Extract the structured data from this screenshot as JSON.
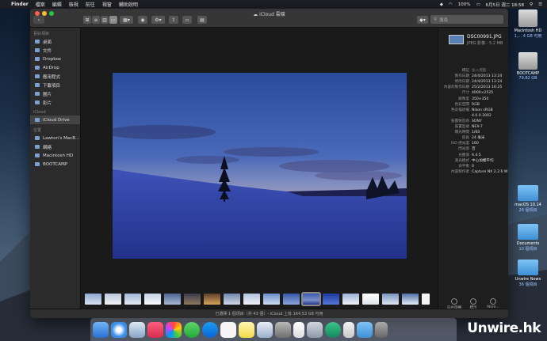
{
  "menubar": {
    "app": "Finder",
    "items": [
      "檔案",
      "編輯",
      "檢視",
      "前往",
      "視窗",
      "輔助說明"
    ],
    "battery": "100%",
    "datetime": "6月5日 週二 18:58"
  },
  "window": {
    "title": "iCloud 雲碟",
    "search_placeholder": "搜尋"
  },
  "sidebar": {
    "favorites_header": "喜好項目",
    "favorites": [
      "桌面",
      "文件",
      "Dropbox",
      "AirDrop",
      "應用程式",
      "下載項目",
      "圖片",
      "影片"
    ],
    "icloud_header": "iCloud",
    "icloud": [
      "iCloud Drive"
    ],
    "locations_header": "位置",
    "locations": [
      "Lawton's MacB...",
      "網絡",
      "Macintosh HD",
      "BOOTCAMP"
    ]
  },
  "info": {
    "filename": "DSC00991.JPG",
    "subtitle": "JPEG 影像 - 5.2 MB",
    "tag_label": "標記",
    "tag_value": "加入標籤…",
    "rows": [
      {
        "k": "製作日期",
        "v": "24/4/2013 13:24"
      },
      {
        "k": "修改日期",
        "v": "24/4/2013 13:24"
      },
      {
        "k": "內容的製作日期",
        "v": "25/2/2013 16:25"
      },
      {
        "k": "尺寸",
        "v": "4000×2525"
      },
      {
        "k": "解像度",
        "v": "350×350"
      },
      {
        "k": "色彩空間",
        "v": "RGB"
      },
      {
        "k": "色彩描述檔",
        "v": "Nikon sRGB"
      },
      {
        "k": "",
        "v": "4.0.0.3002"
      },
      {
        "k": "裝置製造商",
        "v": "SONY"
      },
      {
        "k": "裝置型號",
        "v": "NEX-7"
      },
      {
        "k": "曝光時間",
        "v": "1/60"
      },
      {
        "k": "焦長",
        "v": "24 毫米"
      },
      {
        "k": "ISO 感光度",
        "v": "160"
      },
      {
        "k": "閃光燈",
        "v": "否"
      },
      {
        "k": "光圈值",
        "v": "6.4.5"
      },
      {
        "k": "測光模式",
        "v": "中心加權平均"
      },
      {
        "k": "白平衡",
        "v": "0"
      },
      {
        "k": "內容製作者",
        "v": "Capture NX 2.2.6 W"
      }
    ],
    "actions": [
      "向左旋轉",
      "標示",
      "More..."
    ]
  },
  "statusbar": "已選擇 1 個項目（共 43 個）- iCloud 上有 164.53 GB 可用",
  "desktop": {
    "icons": [
      {
        "name": "Macintosh HD",
        "sub": "1,... 4 GB 可用"
      },
      {
        "name": "BOOTCAMP",
        "sub": "79.82 GB"
      },
      {
        "name": "macOS 10.14",
        "sub": "26 個項目"
      },
      {
        "name": "Documents",
        "sub": "10 個項目"
      },
      {
        "name": "Unwire News",
        "sub": "36 個項目"
      }
    ]
  },
  "watermark": "Unwire.hk"
}
